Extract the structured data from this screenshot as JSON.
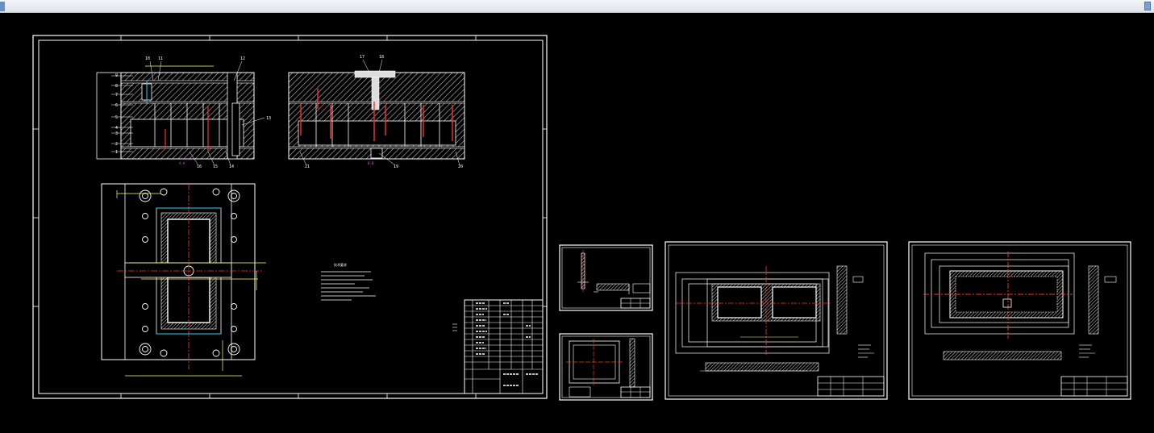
{
  "app": {
    "title_bar": ""
  },
  "colors": {
    "background": "#000000",
    "line": "#ffffff",
    "centerline": "#ff3030",
    "hatch": "#bfbfbf",
    "dimension": "#ffff66",
    "label_magenta": "#ff33ff",
    "accent_cyan": "#22d8ff"
  },
  "drawings": {
    "assembly": {
      "part_numbers_left_section": [
        "1",
        "2",
        "3",
        "4",
        "5",
        "6",
        "7",
        "8",
        "9",
        "10",
        "11",
        "12",
        "13",
        "14",
        "15",
        "16"
      ],
      "part_numbers_right_section": [
        "17",
        "18",
        "19",
        "20",
        "21"
      ],
      "notes_heading": "技术要求",
      "view_labels": [
        "A-A",
        "B-B"
      ]
    },
    "sheet_a4_1": {
      "title_block": ""
    },
    "sheet_a4_2": {
      "title_block": ""
    },
    "sheet_a3_1": {
      "title_block": ""
    },
    "sheet_a3_2": {
      "title_block": ""
    }
  }
}
